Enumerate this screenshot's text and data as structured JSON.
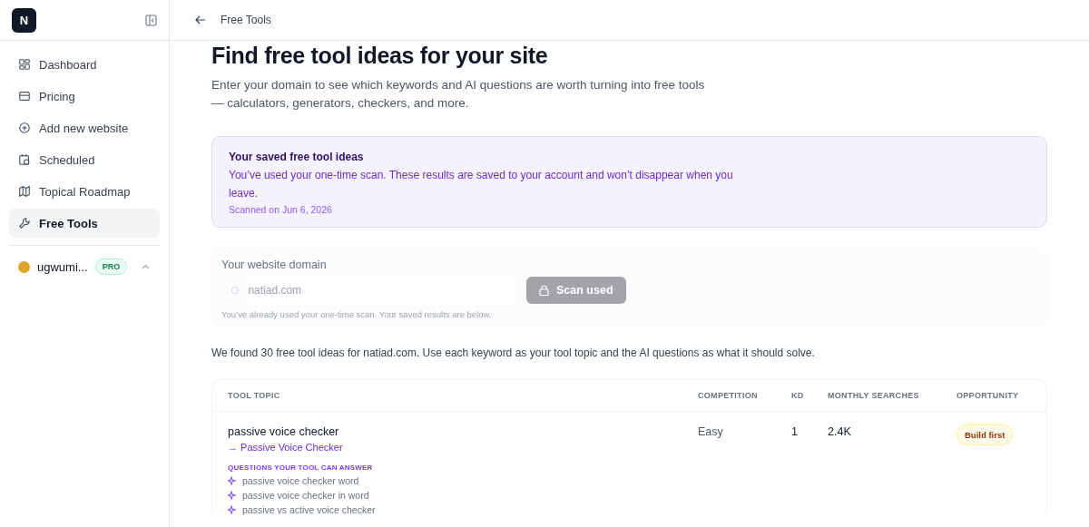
{
  "sidebar": {
    "logo": "N",
    "items": [
      {
        "label": "Dashboard",
        "kind": "grid",
        "selected": false
      },
      {
        "label": "Pricing",
        "kind": "card",
        "selected": false
      },
      {
        "label": "Add new website",
        "kind": "plus",
        "selected": false
      },
      {
        "label": "Scheduled",
        "kind": "calendar",
        "selected": false
      },
      {
        "label": "Topical Roadmap",
        "kind": "map",
        "selected": false
      },
      {
        "label": "Free Tools",
        "kind": "wrench",
        "selected": true
      }
    ],
    "account": {
      "name": "ugwumi...",
      "badge": "PRO",
      "expanded": true
    }
  },
  "topbar": {
    "title": "Free Tools"
  },
  "page": {
    "title": "Find free tool ideas for your site",
    "subtitle": "Enter your domain to see which keywords and AI questions are worth turning into free tools — calculators, generators, checkers, and more."
  },
  "notice": {
    "title": "Your saved free tool ideas",
    "body": "You’ve used your one-time scan. These results are saved to your account and won’t disappear when you leave.",
    "date": "Scanned on Jun 6, 2026"
  },
  "domain_form": {
    "label": "Your website domain",
    "value": "natiad.com",
    "button": "Scan used",
    "button_disabled": true,
    "hint": "You’ve already used your one-time scan. Your saved results are below."
  },
  "summary": "We found 30 free tool ideas for natiad.com. Use each keyword as your tool topic and the AI questions as what it should solve.",
  "table": {
    "columns": [
      "TOOL TOPIC",
      "COMPETITION",
      "KD",
      "MONTHLY SEARCHES",
      "OPPORTUNITY"
    ],
    "rows": [
      {
        "topic": "passive voice checker",
        "link": "→ Passive Voice Checker",
        "questions_label": "QUESTIONS YOUR TOOL CAN ANSWER",
        "questions": [
          "passive voice checker word",
          "passive voice checker in word",
          "passive vs active voice checker"
        ],
        "competition": "Easy",
        "kd": "1",
        "searches": "2.4K",
        "opportunity": "Build first"
      }
    ]
  }
}
